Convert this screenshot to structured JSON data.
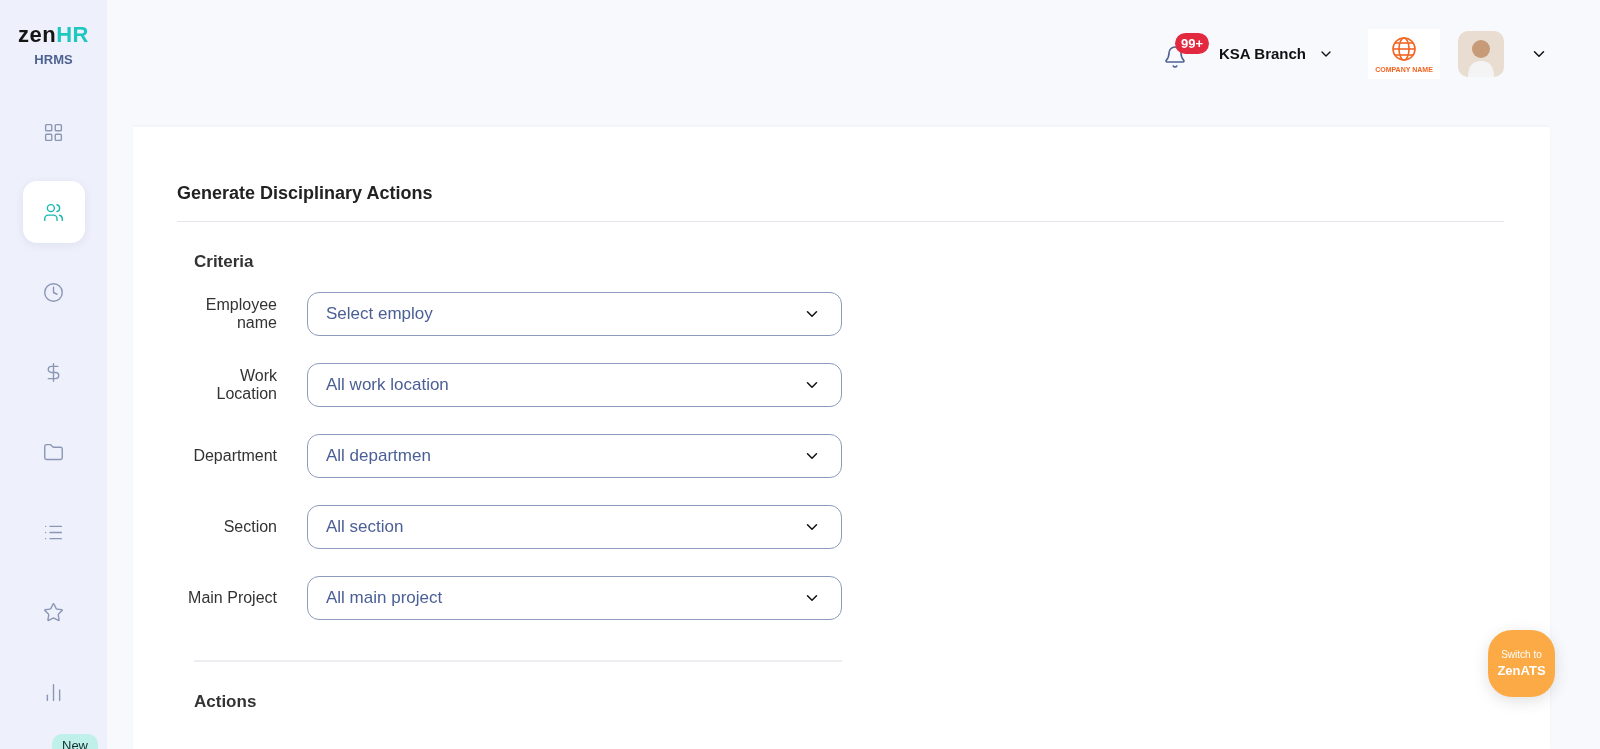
{
  "sidebar": {
    "logo": {
      "first": "zen",
      "second": "HR"
    },
    "subtitle": "HRMS",
    "items": [
      {
        "kind": "grid",
        "selected": false
      },
      {
        "kind": "people",
        "selected": true
      },
      {
        "kind": "clock",
        "selected": false
      },
      {
        "kind": "dollar",
        "selected": false
      },
      {
        "kind": "folder",
        "selected": false
      },
      {
        "kind": "list",
        "selected": false
      },
      {
        "kind": "star",
        "selected": false
      },
      {
        "kind": "chart",
        "selected": false
      }
    ],
    "new_badge": "New"
  },
  "header": {
    "notifications": "99+",
    "branch": "KSA Branch",
    "company_logo": "COMPANY NAME"
  },
  "page": {
    "title": "Generate Disciplinary Actions",
    "criteria_title": "Criteria",
    "fields": [
      {
        "label": "Employee name",
        "value": "Select employ"
      },
      {
        "label": "Work Location",
        "value": "All work location"
      },
      {
        "label": "Department",
        "value": "All departmen"
      },
      {
        "label": "Section",
        "value": "All section"
      },
      {
        "label": "Main Project",
        "value": "All main project"
      }
    ],
    "actions_title": "Actions"
  },
  "switch_button": {
    "line_1": "Switch to",
    "line_2": "ZenATS"
  }
}
